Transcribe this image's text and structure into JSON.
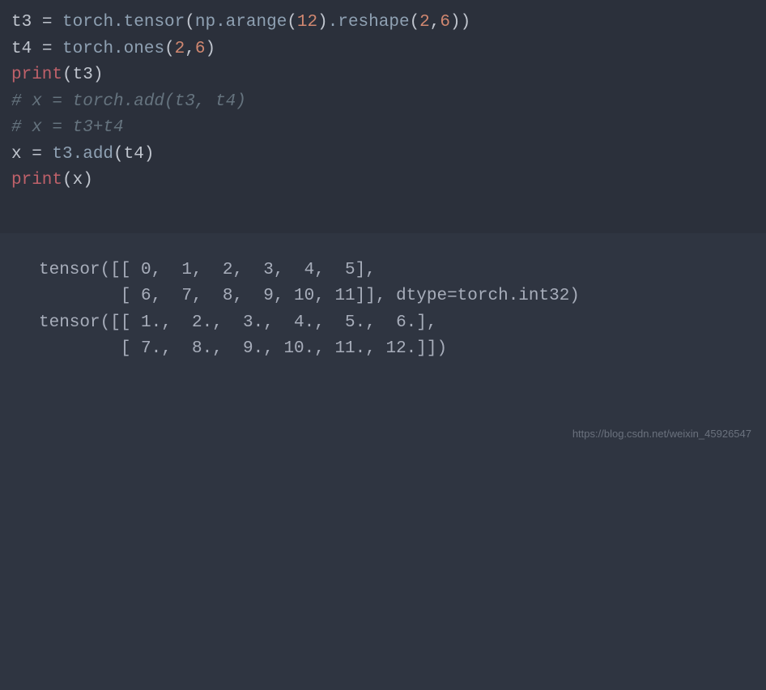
{
  "code": {
    "line1": {
      "v1": "t3",
      "eq": " = ",
      "f1": "torch.tensor",
      "p1": "(",
      "f2": "np.arange",
      "p2": "(",
      "n1": "12",
      "p3": ")",
      "f3": ".reshape",
      "p4": "(",
      "n2": "2",
      "c1": ",",
      "n3": "6",
      "p5": "))"
    },
    "line2": {
      "v1": "t4",
      "eq": " = ",
      "f1": "torch.ones",
      "p1": "(",
      "n1": "2",
      "c1": ",",
      "n2": "6",
      "p2": ")"
    },
    "line3": {
      "f1": "print",
      "p1": "(",
      "v1": "t3",
      "p2": ")"
    },
    "line4": "# x = torch.add(t3, t4)",
    "line5": "# x = t3+t4",
    "line6": {
      "v1": "x",
      "eq": " = ",
      "f1": "t3.add",
      "p1": "(",
      "v2": "t4",
      "p2": ")"
    },
    "line7": {
      "f1": "print",
      "p1": "(",
      "v1": "x",
      "p2": ")"
    }
  },
  "output": {
    "line1": "tensor([[ 0,  1,  2,  3,  4,  5],",
    "line2": "        [ 6,  7,  8,  9, 10, 11]], dtype=torch.int32)",
    "line3": "tensor([[ 1.,  2.,  3.,  4.,  5.,  6.],",
    "line4": "        [ 7.,  8.,  9., 10., 11., 12.]])"
  },
  "watermark": "https://blog.csdn.net/weixin_45926547"
}
